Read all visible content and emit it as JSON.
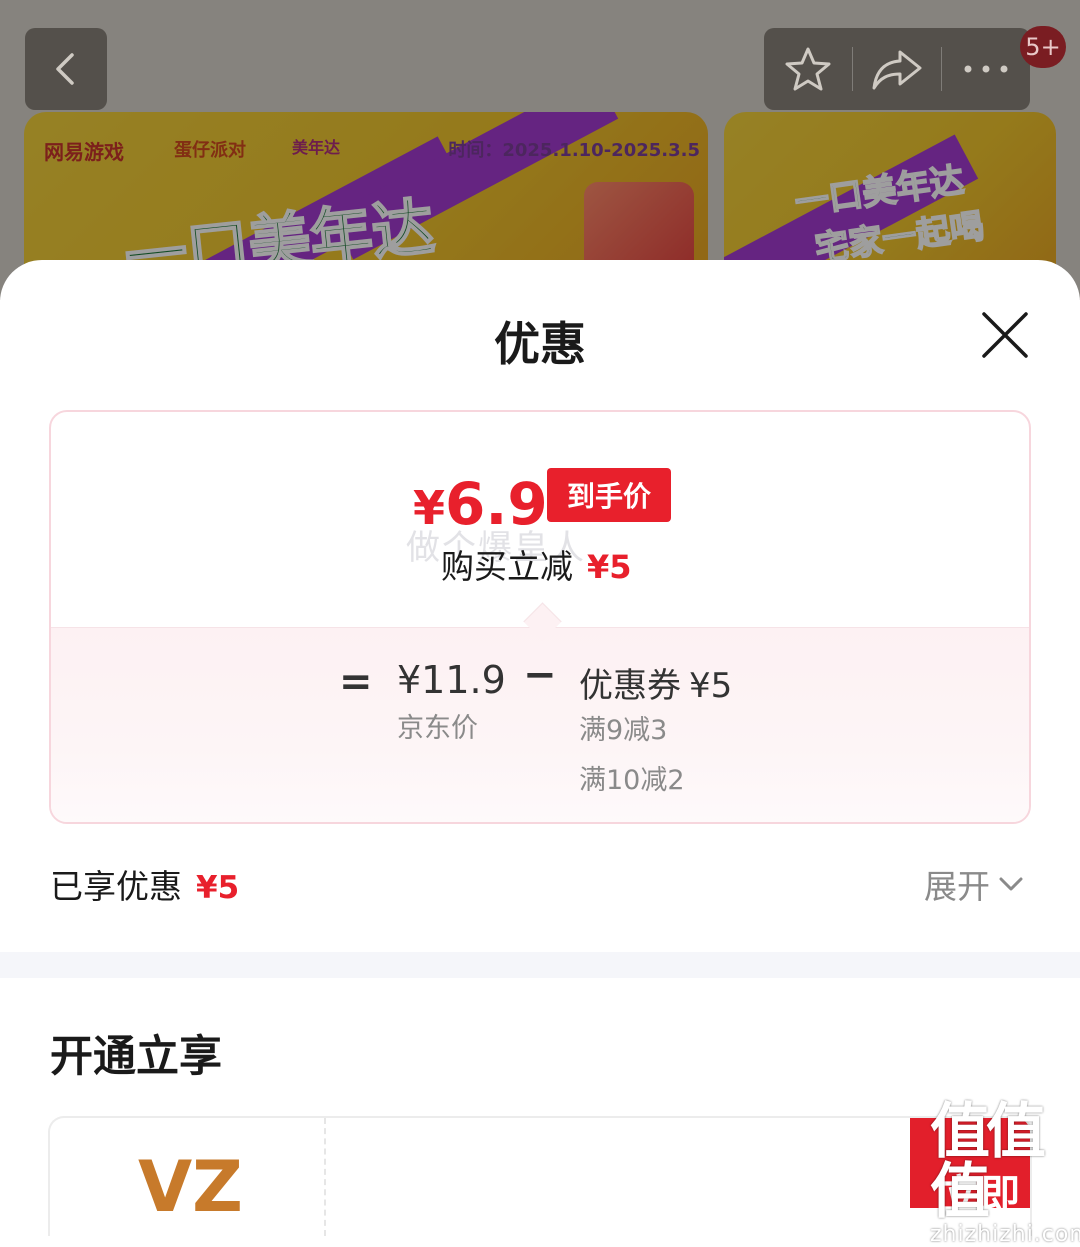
{
  "background": {
    "banner1": {
      "brand": "网易游戏",
      "brand2": "蛋仔派对",
      "brand3": "美年达",
      "date": "时间：2025.1.10-2025.3.5",
      "headline": "一口美年达"
    },
    "banner2": {
      "line1": "一口美年达",
      "line2": "宅家一起喝"
    },
    "nav": {
      "badge": "5+",
      "icons": [
        "back-icon",
        "star-icon",
        "share-icon",
        "more-icon"
      ]
    }
  },
  "sheet": {
    "title": "优惠",
    "close_icon": "close-icon",
    "price_card": {
      "final_currency": "¥",
      "final_amount": "6.9",
      "price_tag": "到手价",
      "watermark": "做个爆皇人",
      "reduce_label": "购买立减",
      "reduce_value": "¥5",
      "equals": "=",
      "jd_price": "¥11.9",
      "jd_label": "京东价",
      "minus": "−",
      "coupon_label": "优惠券",
      "coupon_value": "¥5",
      "coupon_rules": [
        "满9减3",
        "满10减2"
      ]
    },
    "enjoyed": {
      "label": "已享优惠",
      "value": "¥5"
    },
    "expand_label": "展开",
    "section_title": "开通立享",
    "member_card": {
      "logo_text": "VZ",
      "red_text": "立即"
    },
    "site_watermark": {
      "glyph": "值值值",
      "url": "zhizhizhi.com"
    }
  },
  "colors": {
    "accent_red": "#e8202c",
    "text_dark": "#1a1a1a",
    "text_gray": "#8a8a8a",
    "card_border": "#f7d6dd",
    "card_tint": "#fdf1f3"
  }
}
